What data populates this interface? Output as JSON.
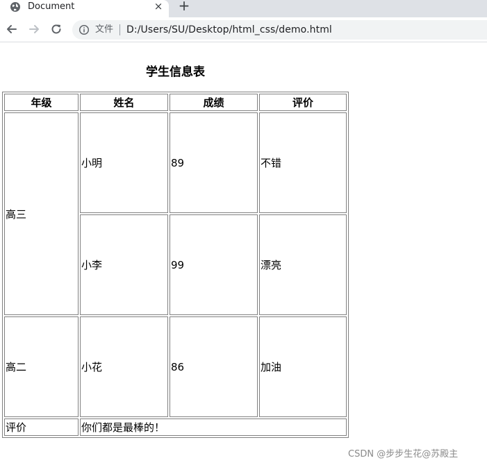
{
  "browser": {
    "tab_title": "Document",
    "close_glyph": "×",
    "newtab_glyph": "+",
    "address_scheme": "文件",
    "address_url": "D:/Users/SU/Desktop/html_css/demo.html",
    "icons": [
      "globe-icon",
      "close-icon",
      "plus-icon",
      "back-arrow-icon",
      "forward-arrow-icon",
      "reload-icon",
      "info-icon"
    ]
  },
  "table": {
    "caption": "学生信息表",
    "headers": [
      "年级",
      "姓名",
      "成绩",
      "评价"
    ],
    "groups": [
      {
        "grade": "高三",
        "rows": [
          {
            "name": "小明",
            "score": "89",
            "comment": "不错"
          },
          {
            "name": "小李",
            "score": "99",
            "comment": "漂亮"
          }
        ]
      },
      {
        "grade": "高二",
        "rows": [
          {
            "name": "小花",
            "score": "86",
            "comment": "加油"
          }
        ]
      }
    ],
    "footer": {
      "label": "评价",
      "text": "你们都是最棒的！"
    }
  },
  "watermark": "CSDN @步步生花@苏殿主"
}
